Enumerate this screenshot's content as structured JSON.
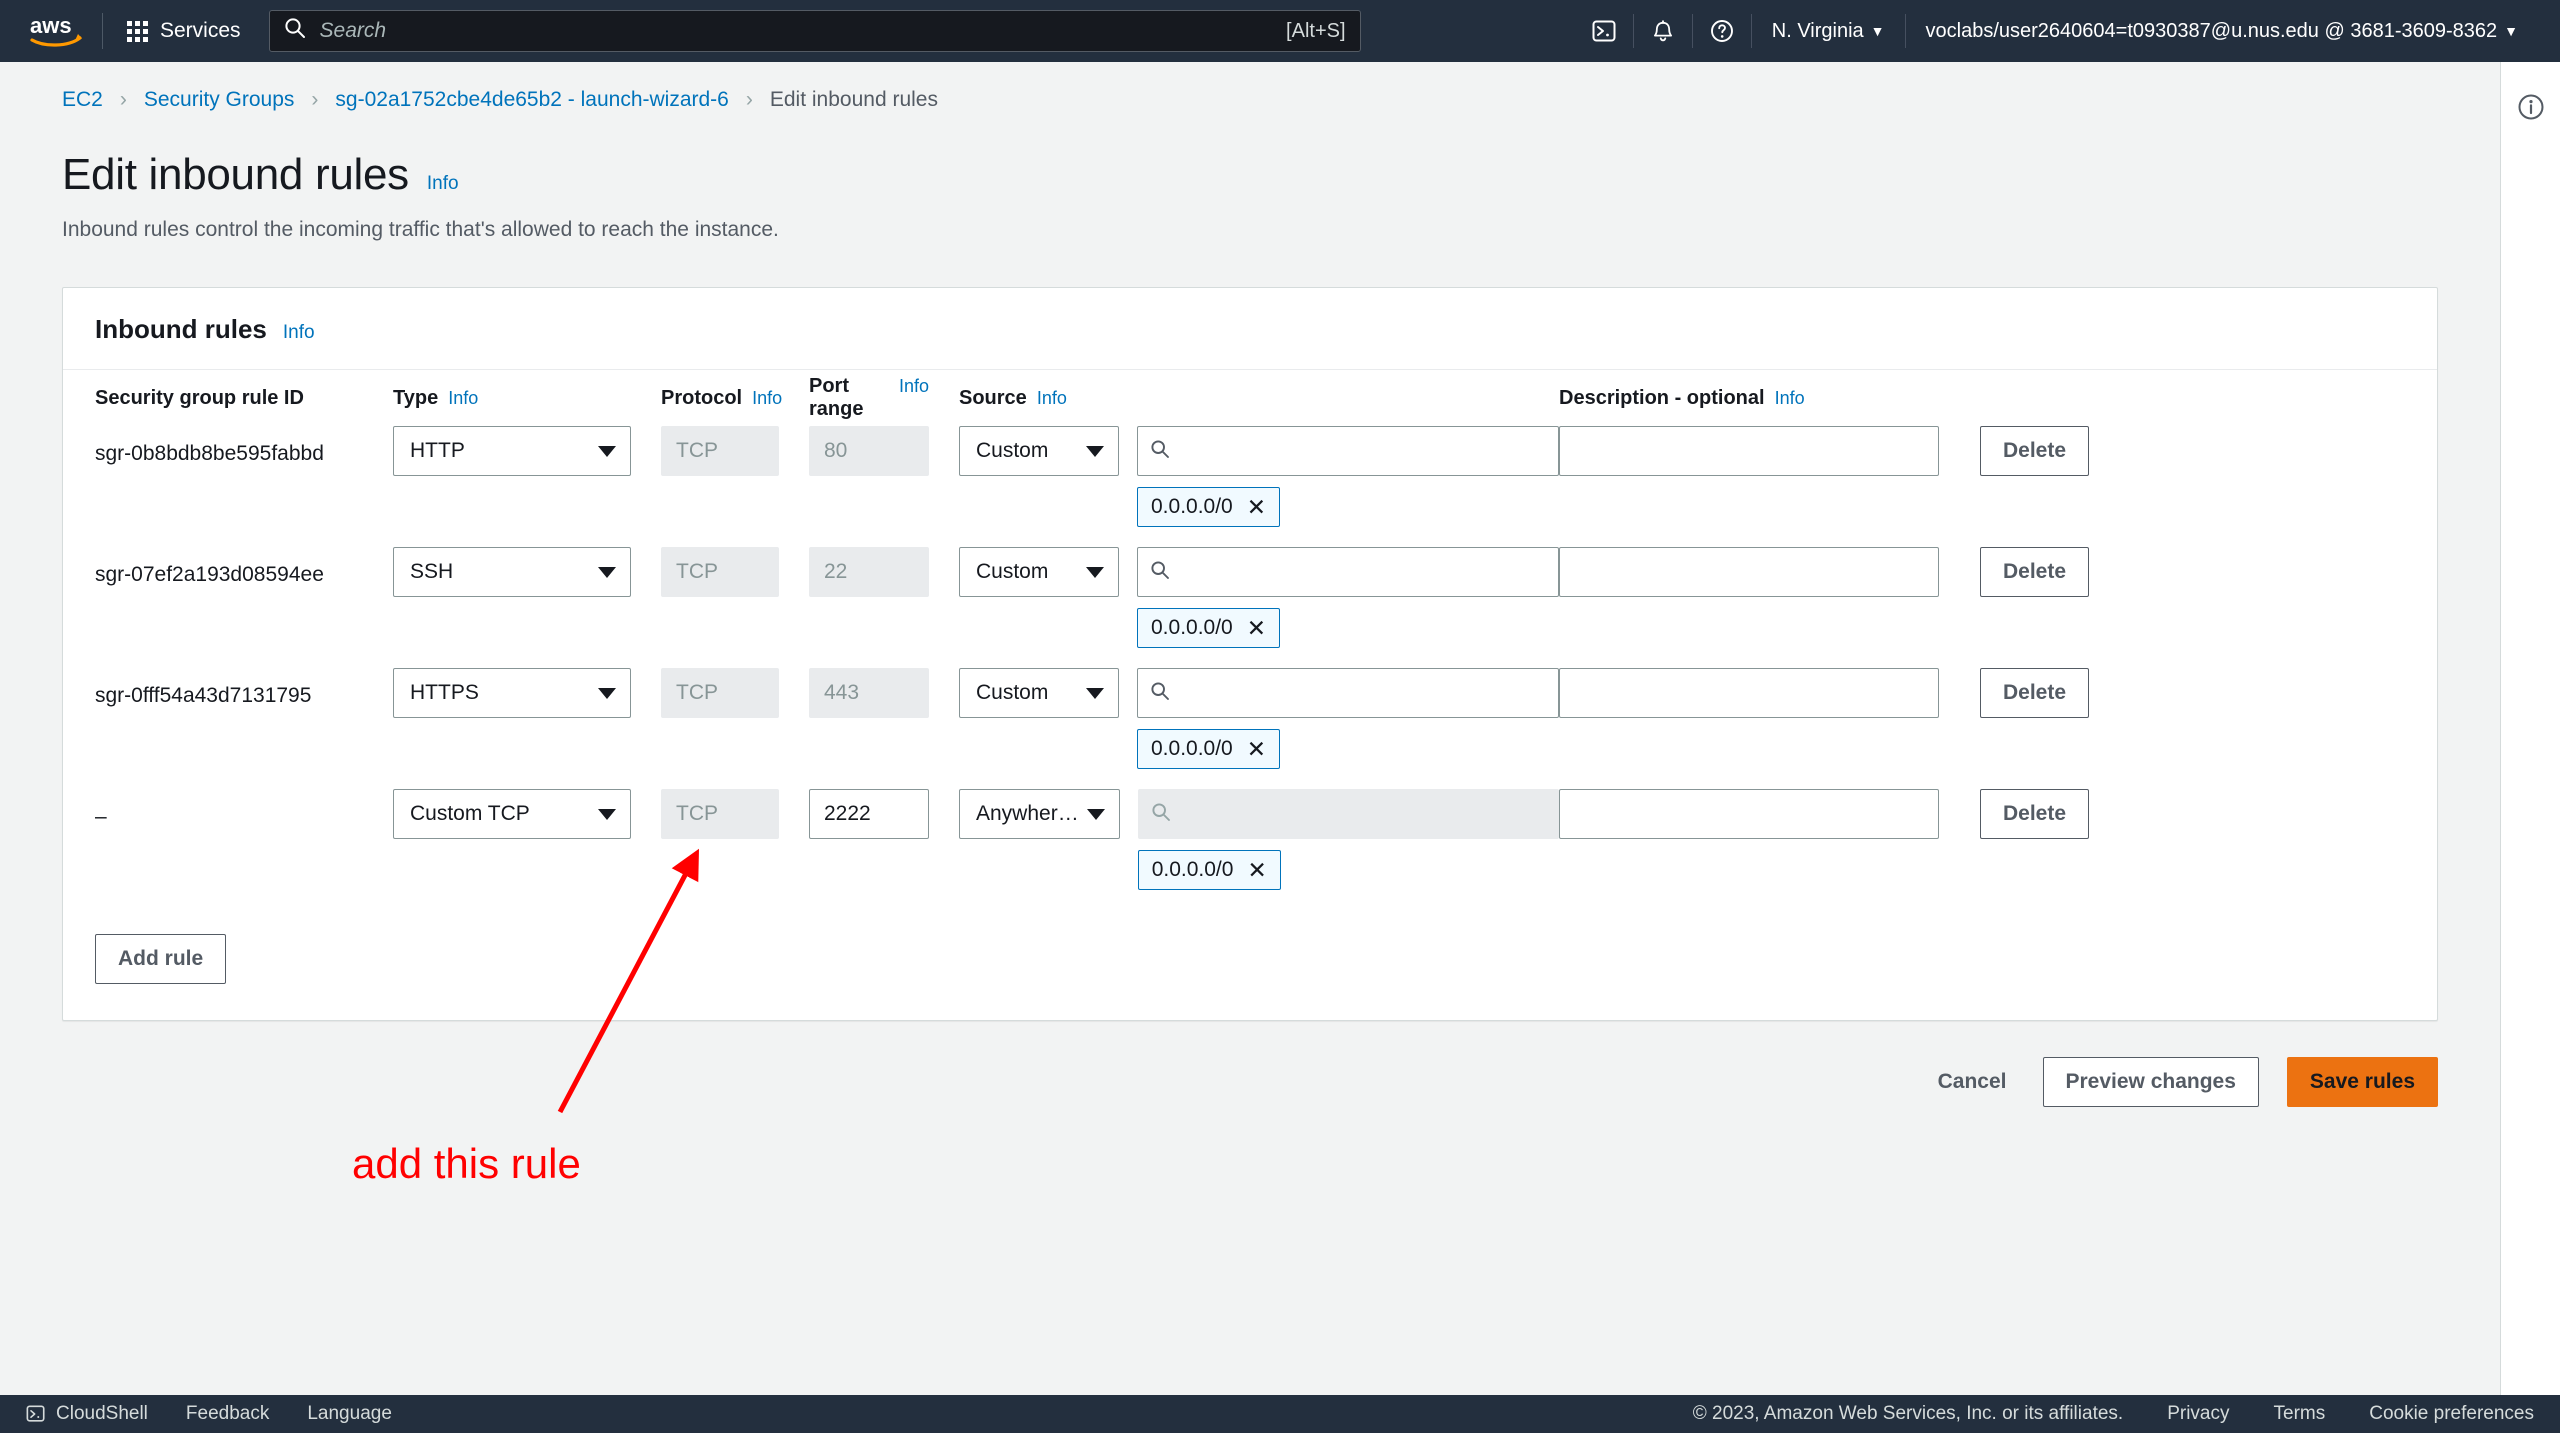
{
  "topnav": {
    "logo_alt": "aws",
    "services_label": "Services",
    "search_placeholder": "Search",
    "search_value": "",
    "search_shortcut": "[Alt+S]",
    "cloudshell_icon": "terminal-icon",
    "notifications_icon": "bell-icon",
    "help_icon": "question-circle-icon",
    "region_label": "N. Virginia",
    "account_label": "voclabs/user2640604=t0930387@u.nus.edu @ 3681-3609-8362",
    "caret": "▼"
  },
  "breadcrumb": {
    "items": [
      {
        "label": "EC2",
        "current": false
      },
      {
        "label": "Security Groups",
        "current": false
      },
      {
        "label": "sg-02a1752cbe4de65b2 - launch-wizard-6",
        "current": false
      },
      {
        "label": "Edit inbound rules",
        "current": true
      }
    ],
    "separator": "›"
  },
  "page": {
    "title": "Edit inbound rules",
    "title_info": "Info",
    "description": "Inbound rules control the incoming traffic that's allowed to reach the instance."
  },
  "card": {
    "title": "Inbound rules",
    "title_info": "Info",
    "add_rule_label": "Add rule",
    "columns": [
      {
        "label": "Security group rule ID",
        "info": ""
      },
      {
        "label": "Type",
        "info": "Info"
      },
      {
        "label": "Protocol",
        "info": "Info"
      },
      {
        "label": "Port range",
        "info": "Info"
      },
      {
        "label": "Source",
        "info": "Info"
      },
      {
        "label": "Description - optional",
        "info": "Info"
      }
    ],
    "delete_label": "Delete",
    "source_search_placeholder": "",
    "description_placeholder": "",
    "rows": [
      {
        "rule_id": "sgr-0b8bdb8be595fabbd",
        "type": "HTTP",
        "protocol": "TCP",
        "port_range": "80",
        "source_type": "Custom",
        "source_value": "",
        "source_token": "0.0.0.0/0",
        "description": "",
        "source_disabled": false
      },
      {
        "rule_id": "sgr-07ef2a193d08594ee",
        "type": "SSH",
        "protocol": "TCP",
        "port_range": "22",
        "source_type": "Custom",
        "source_value": "",
        "source_token": "0.0.0.0/0",
        "description": "",
        "source_disabled": false
      },
      {
        "rule_id": "sgr-0fff54a43d7131795",
        "type": "HTTPS",
        "protocol": "TCP",
        "port_range": "443",
        "source_type": "Custom",
        "source_value": "",
        "source_token": "0.0.0.0/0",
        "description": "",
        "source_disabled": false
      },
      {
        "rule_id": "–",
        "type": "Custom TCP",
        "protocol": "TCP",
        "port_range": "2222",
        "source_type": "Anywher…",
        "source_value": "",
        "source_token": "0.0.0.0/0",
        "description": "",
        "source_disabled": true
      }
    ]
  },
  "actions": {
    "cancel_label": "Cancel",
    "preview_label": "Preview changes",
    "save_label": "Save rules"
  },
  "annotation": {
    "text": "add this rule",
    "color": "#ff0000"
  },
  "footer": {
    "cloudshell_label": "CloudShell",
    "feedback_label": "Feedback",
    "language_label": "Language",
    "copyright": "© 2023, Amazon Web Services, Inc. or its affiliates.",
    "privacy_label": "Privacy",
    "terms_label": "Terms",
    "cookie_label": "Cookie preferences"
  },
  "colors": {
    "accent_orange": "#ec7211",
    "link_blue": "#0073bb",
    "nav_dark": "#232f3e",
    "annotation_red": "#ff0000"
  }
}
